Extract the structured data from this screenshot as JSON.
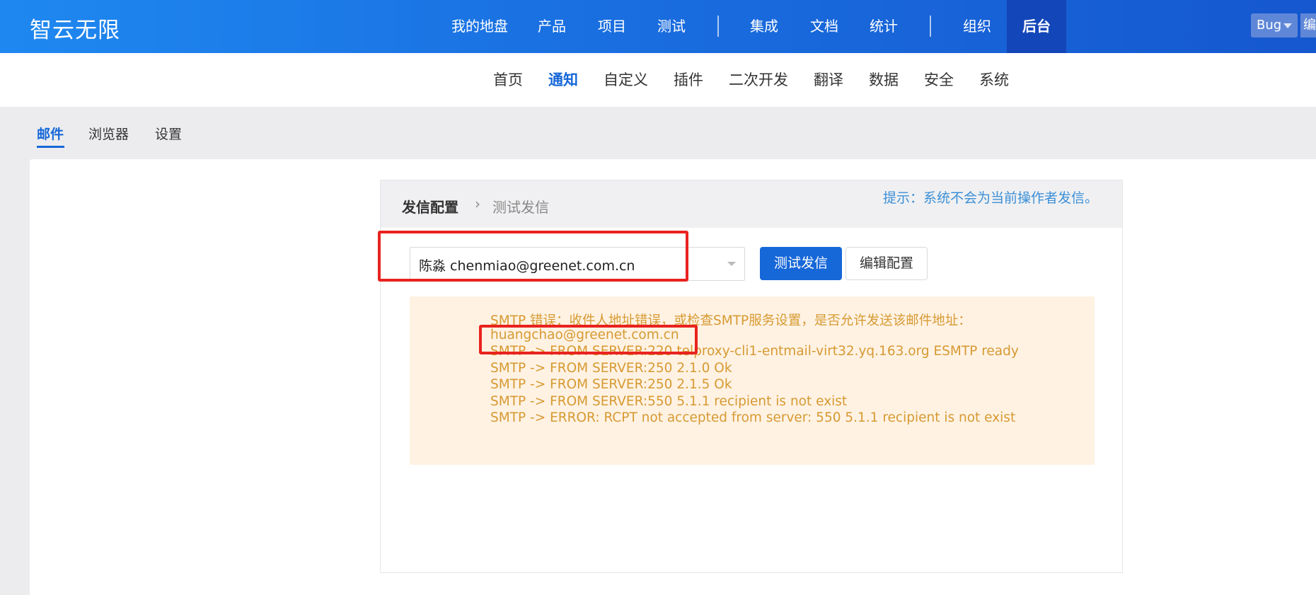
{
  "header": {
    "brand": "智云无限",
    "nav": [
      "我的地盘",
      "产品",
      "项目",
      "测试",
      "集成",
      "文档",
      "统计",
      "组织",
      "后台"
    ],
    "active": "后台",
    "bug_select": "Bug",
    "edit_cut": "编"
  },
  "subnav": {
    "items": [
      "首页",
      "通知",
      "自定义",
      "插件",
      "二次开发",
      "翻译",
      "数据",
      "安全",
      "系统"
    ],
    "active": "通知"
  },
  "tabs": {
    "items": [
      "邮件",
      "浏览器",
      "设置"
    ],
    "active": "邮件"
  },
  "card": {
    "breadcrumb_main": "发信配置",
    "breadcrumb_sep": "›",
    "breadcrumb_sub": "测试发信",
    "tip": "提示：系统不会为当前操作者发信。",
    "recipient_value": "陈淼 chenmiao@greenet.com.cn",
    "test_button": "测试发信",
    "edit_button": "编辑配置"
  },
  "error": {
    "lines": [
      "SMTP 错误：收件人地址错误，或检查SMTP服务设置，是否允许发送该邮件地址：",
      "huangchao@greenet.com.cn",
      "SMTP -> FROM SERVER:220 telproxy-cli1-entmail-virt32.yq.163.org ESMTP ready",
      "SMTP -> FROM SERVER:250 2.1.0 Ok",
      "SMTP -> FROM SERVER:250 2.1.5 Ok",
      "SMTP -> FROM SERVER:550 5.1.1 recipient is not exist",
      "SMTP -> ERROR: RCPT not accepted from server: 550 5.1.1 recipient is not exist"
    ]
  },
  "colors": {
    "primary": "#1667d8",
    "header": "#1a6fe0",
    "error_text": "#d69a32",
    "error_bg": "#fff2e3",
    "highlight": "#e8231f"
  }
}
